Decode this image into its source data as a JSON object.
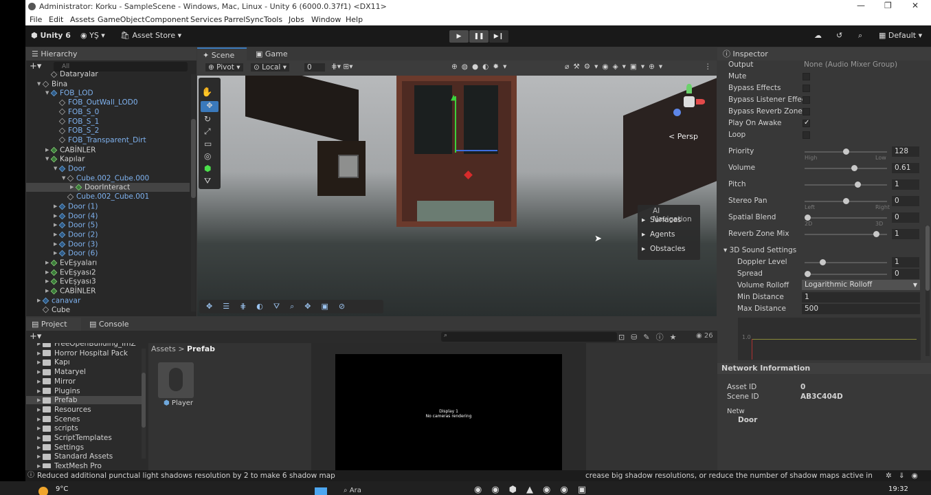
{
  "titlebar": {
    "title": "Administrator: Korku - SampleScene - Windows, Mac, Linux - Unity 6 (6000.0.37f1) <DX11>"
  },
  "menu": [
    "File",
    "Edit",
    "Assets",
    "GameObject",
    "Component",
    "Services",
    "ParrelSync",
    "Tools",
    "Jobs",
    "Window",
    "Help"
  ],
  "toolbar": {
    "unity_label": "Unity 6",
    "account": "YŞ",
    "asset_store": "Asset Store",
    "layout": "Default"
  },
  "hierarchy": {
    "tab": "Hierarchy",
    "search_placeholder": "All",
    "rows": [
      {
        "label": "Dataryalar",
        "indent": 2,
        "color": "white",
        "icon": "cube"
      },
      {
        "label": "Bina",
        "indent": 1,
        "color": "white",
        "icon": "cube",
        "arrow": "down"
      },
      {
        "label": "FOB_LOD",
        "indent": 2,
        "color": "blue",
        "icon": "prefab",
        "arrow": "down"
      },
      {
        "label": "FOB_OutWall_LOD0",
        "indent": 3,
        "color": "blue",
        "icon": "cube"
      },
      {
        "label": "FOB_S_0",
        "indent": 3,
        "color": "blue",
        "icon": "cube"
      },
      {
        "label": "FOB_S_1",
        "indent": 3,
        "color": "blue",
        "icon": "cube"
      },
      {
        "label": "FOB_S_2",
        "indent": 3,
        "color": "blue",
        "icon": "cube"
      },
      {
        "label": "FOB_Transparent_Dirt",
        "indent": 3,
        "color": "blue",
        "icon": "cube"
      },
      {
        "label": "CABİNLER",
        "indent": 2,
        "color": "white",
        "icon": "green",
        "arrow": "right"
      },
      {
        "label": "Kapılar",
        "indent": 2,
        "color": "white",
        "icon": "green",
        "arrow": "down"
      },
      {
        "label": "Door",
        "indent": 3,
        "color": "blue",
        "icon": "prefab",
        "arrow": "down"
      },
      {
        "label": "Cube.002_Cube.000",
        "indent": 4,
        "color": "blue",
        "icon": "cube",
        "arrow": "down"
      },
      {
        "label": "DoorInteract",
        "indent": 5,
        "color": "white",
        "icon": "green",
        "arrow": "right",
        "selected": true
      },
      {
        "label": "Cube.002_Cube.001",
        "indent": 4,
        "color": "blue",
        "icon": "cube"
      },
      {
        "label": "Door (1)",
        "indent": 3,
        "color": "blue",
        "icon": "prefab",
        "arrow": "right"
      },
      {
        "label": "Door (4)",
        "indent": 3,
        "color": "blue",
        "icon": "prefab",
        "arrow": "right"
      },
      {
        "label": "Door (5)",
        "indent": 3,
        "color": "blue",
        "icon": "prefab",
        "arrow": "right"
      },
      {
        "label": "Door (2)",
        "indent": 3,
        "color": "blue",
        "icon": "prefab",
        "arrow": "right"
      },
      {
        "label": "Door (3)",
        "indent": 3,
        "color": "blue",
        "icon": "prefab",
        "arrow": "right"
      },
      {
        "label": "Door (6)",
        "indent": 3,
        "color": "blue",
        "icon": "prefab",
        "arrow": "right"
      },
      {
        "label": "EvEşyaları",
        "indent": 2,
        "color": "white",
        "icon": "green",
        "arrow": "right"
      },
      {
        "label": "EvEşyası2",
        "indent": 2,
        "color": "white",
        "icon": "green",
        "arrow": "right"
      },
      {
        "label": "EvEşyası3",
        "indent": 2,
        "color": "white",
        "icon": "green",
        "arrow": "right"
      },
      {
        "label": "CABİNLER",
        "indent": 2,
        "color": "white",
        "icon": "green",
        "arrow": "right"
      },
      {
        "label": "canavar",
        "indent": 1,
        "color": "blue",
        "icon": "prefab",
        "arrow": "right"
      },
      {
        "label": "Cube",
        "indent": 1,
        "color": "white",
        "icon": "cube"
      }
    ]
  },
  "scene": {
    "tab_scene": "Scene",
    "tab_game": "Game",
    "pivot": "Pivot",
    "local": "Local",
    "snap": "0",
    "persp": "< Persp",
    "ai_nav": {
      "title": "AI Navigation",
      "items": [
        "Surfaces",
        "Agents",
        "Obstacles"
      ]
    }
  },
  "inspector": {
    "tab": "Inspector",
    "output_label": "Output",
    "output_value": "None (Audio Mixer Group)",
    "toggles": [
      {
        "label": "Mute",
        "checked": false
      },
      {
        "label": "Bypass Effects",
        "checked": false
      },
      {
        "label": "Bypass Listener Effec",
        "checked": false
      },
      {
        "label": "Bypass Reverb Zones",
        "checked": false
      },
      {
        "label": "Play On Awake",
        "checked": true
      },
      {
        "label": "Loop",
        "checked": false
      }
    ],
    "sliders": [
      {
        "label": "Priority",
        "value": "128",
        "pos": 0.5,
        "left": "High",
        "right": "Low"
      },
      {
        "label": "Volume",
        "value": "0.61",
        "pos": 0.61
      },
      {
        "label": "Pitch",
        "value": "1",
        "pos": 0.66
      },
      {
        "label": "Stereo Pan",
        "value": "0",
        "pos": 0.5,
        "left": "Left",
        "right": "Right"
      },
      {
        "label": "Spatial Blend",
        "value": "0",
        "pos": 0.0,
        "left": "2D",
        "right": "3D"
      },
      {
        "label": "Reverb Zone Mix",
        "value": "1",
        "pos": 0.9
      }
    ],
    "sound3d": {
      "header": "3D Sound Settings",
      "doppler_label": "Doppler Level",
      "doppler_value": "1",
      "doppler_pos": 0.2,
      "spread_label": "Spread",
      "spread_value": "0",
      "spread_pos": 0.0,
      "rolloff_label": "Volume Rolloff",
      "rolloff_value": "Logarithmic Rolloff",
      "min_label": "Min Distance",
      "min_value": "1",
      "max_label": "Max Distance",
      "max_value": "500",
      "graph_tick": "1.0"
    },
    "network": {
      "header": "Network Information",
      "asset_id_label": "Asset ID",
      "asset_id_value": "0",
      "scene_id_label": "Scene ID",
      "scene_id_value": "AB3C404D",
      "netw_label": "Netw",
      "door_value": "Door"
    }
  },
  "project": {
    "tab_project": "Project",
    "tab_console": "Console",
    "breadcrumb_root": "Assets",
    "breadcrumb_sep": ">",
    "breadcrumb_current": "Prefab",
    "count": "26",
    "folders": [
      "FreeOpenBuilding_ImZ",
      "Horror Hospital Pack",
      "Kapı",
      "Mataryel",
      "Mirror",
      "Plugins",
      "Prefab",
      "Resources",
      "Scenes",
      "scripts",
      "ScriptTemplates",
      "Settings",
      "Standard Assets",
      "TextMesh Pro"
    ],
    "selected_folder": "Prefab",
    "asset_name": "Player",
    "game_preview": {
      "line1": "Display 1",
      "line2": "No cameras rendering"
    }
  },
  "status": {
    "message": "Reduced additional punctual light shadows resolution by 2 to make 6 shadow map",
    "message_tail": "crease big shadow resolutions, or reduce the number of shadow maps active in the"
  },
  "taskbar": {
    "temperature": "9°C",
    "search": "Ara",
    "time": "19:32"
  }
}
